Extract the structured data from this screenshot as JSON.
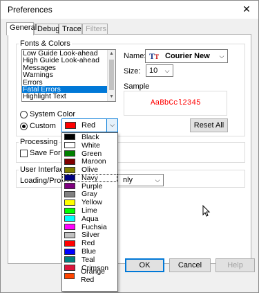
{
  "window": {
    "title": "Preferences",
    "close_glyph": "✕"
  },
  "tabs": [
    {
      "label": "General",
      "active": true,
      "enabled": true
    },
    {
      "label": "Debug",
      "active": false,
      "enabled": true
    },
    {
      "label": "Trace",
      "active": false,
      "enabled": true
    },
    {
      "label": "Filters",
      "active": false,
      "enabled": false
    }
  ],
  "fonts_colors": {
    "group_label": "Fonts & Colors",
    "items": [
      "Low Guide Look-ahead",
      "High Guide Look-ahead",
      "Messages",
      "Warnings",
      "Errors",
      "Fatal Errors",
      "Highlight Text"
    ],
    "selected_index": 5,
    "name_label": "Name:",
    "font_name": "Courier New",
    "font_icon": "truetype-font-icon",
    "size_label": "Size:",
    "size_value": "10",
    "sample_label": "Sample",
    "sample_text": "AaBbCcl2345",
    "system_color_label": "System Color",
    "custom_label": "Custom",
    "color_mode": "custom",
    "color_value": "Red",
    "reset_all_label": "Reset All"
  },
  "processing": {
    "group_label": "Processing",
    "save_label": "Save For Re",
    "checked": false
  },
  "user_interface": {
    "group_label": "User Interface",
    "loading_label": "Loading/Proces",
    "combo_value": "nly"
  },
  "color_options": [
    {
      "name": "Black",
      "hex": "#000000"
    },
    {
      "name": "White",
      "hex": "#ffffff"
    },
    {
      "name": "Green",
      "hex": "#008000"
    },
    {
      "name": "Maroon",
      "hex": "#800000"
    },
    {
      "name": "Olive",
      "hex": "#808000"
    },
    {
      "name": "Navy",
      "hex": "#000080"
    },
    {
      "name": "Purple",
      "hex": "#800080"
    },
    {
      "name": "Gray",
      "hex": "#808080"
    },
    {
      "name": "Yellow",
      "hex": "#ffff00"
    },
    {
      "name": "Lime",
      "hex": "#00ff00"
    },
    {
      "name": "Aqua",
      "hex": "#00ffff"
    },
    {
      "name": "Fuchsia",
      "hex": "#ff00ff"
    },
    {
      "name": "Silver",
      "hex": "#c0c0c0"
    },
    {
      "name": "Red",
      "hex": "#ff0000"
    },
    {
      "name": "Blue",
      "hex": "#0000ff"
    },
    {
      "name": "Teal",
      "hex": "#008080"
    },
    {
      "name": "Crimson",
      "hex": "#dc143c"
    },
    {
      "name": "Orange Red",
      "hex": "#ff4500"
    }
  ],
  "highlighted_color_index": 5,
  "footer": {
    "ok_label": "OK",
    "cancel_label": "Cancel",
    "help_label": "Help"
  },
  "colors": {
    "selection": "#0078d7",
    "accent": "#0078d7",
    "sample_text": "#ff0000"
  }
}
